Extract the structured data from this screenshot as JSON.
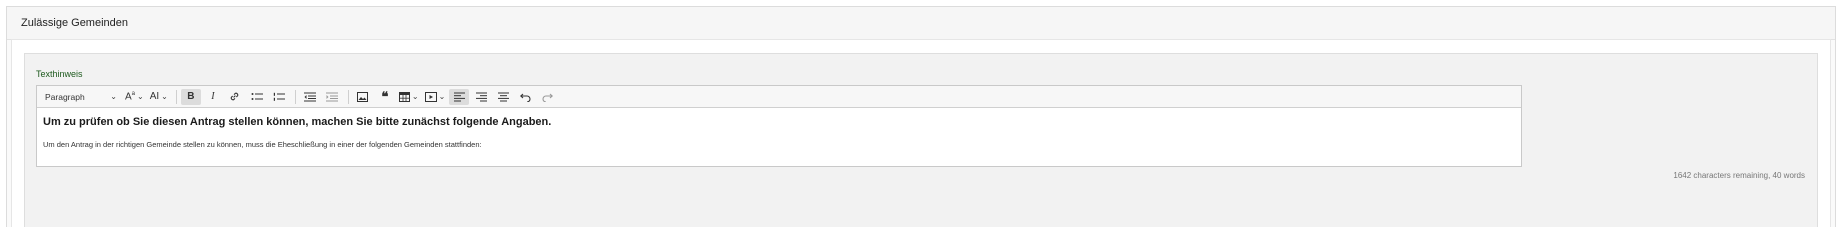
{
  "section": {
    "title": "Zulässige Gemeinden"
  },
  "field": {
    "label": "Texthinweis"
  },
  "toolbar": {
    "paragraph_select": "Paragraph",
    "font_size_label": "A",
    "font_family_label": "AI",
    "bold_label": "B",
    "italic_label": "I"
  },
  "editor": {
    "heading": "Um zu prüfen ob Sie diesen Antrag stellen können, machen Sie bitte zunächst folgende Angaben.",
    "paragraph": "Um den Antrag in der richtigen Gemeinde stellen zu können, muss  die Eheschließung in einer der folgenden Gemeinden stattfinden:"
  },
  "status": {
    "word_count": "1642 characters remaining, 40 words"
  },
  "icons": [
    "chevron-down-icon",
    "font-size-icon",
    "font-family-icon",
    "bold-icon",
    "italic-icon",
    "link-icon",
    "bulleted-list-icon",
    "numbered-list-icon",
    "outdent-icon",
    "indent-icon",
    "image-icon",
    "quote-icon",
    "table-icon",
    "media-icon",
    "align-left-icon",
    "align-right-icon",
    "align-center-icon",
    "undo-icon",
    "redo-icon"
  ]
}
